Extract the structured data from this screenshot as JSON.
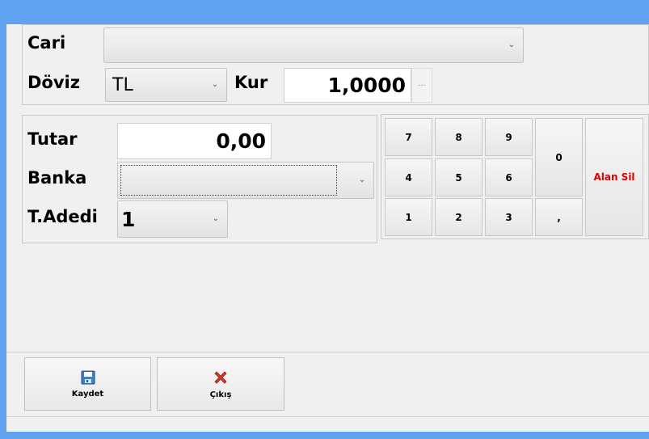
{
  "header": {
    "cari_label": "Cari",
    "cari_value": "",
    "doviz_label": "Döviz",
    "doviz_value": "TL",
    "kur_label": "Kur",
    "kur_value": "1,0000",
    "kur_button": "..."
  },
  "form": {
    "tutar_label": "Tutar",
    "tutar_value": "0,00",
    "banka_label": "Banka",
    "banka_value": "",
    "adet_label": "T.Adedi",
    "adet_value": "1"
  },
  "keypad": {
    "k7": "7",
    "k8": "8",
    "k9": "9",
    "k4": "4",
    "k5": "5",
    "k6": "6",
    "k1": "1",
    "k2": "2",
    "k3": "3",
    "k0": "0",
    "comma": ",",
    "clear": "Alan Sil"
  },
  "colors": {
    "frame": "#5fa2f0",
    "clear_text": "#e00000",
    "exit_icon": "#d63a2f",
    "save_icon": "#3a7fc8"
  },
  "footer": {
    "save_label": "Kaydet",
    "save_icon": "floppy-disk-icon",
    "exit_label": "Çıkış",
    "exit_icon": "red-x-icon"
  }
}
